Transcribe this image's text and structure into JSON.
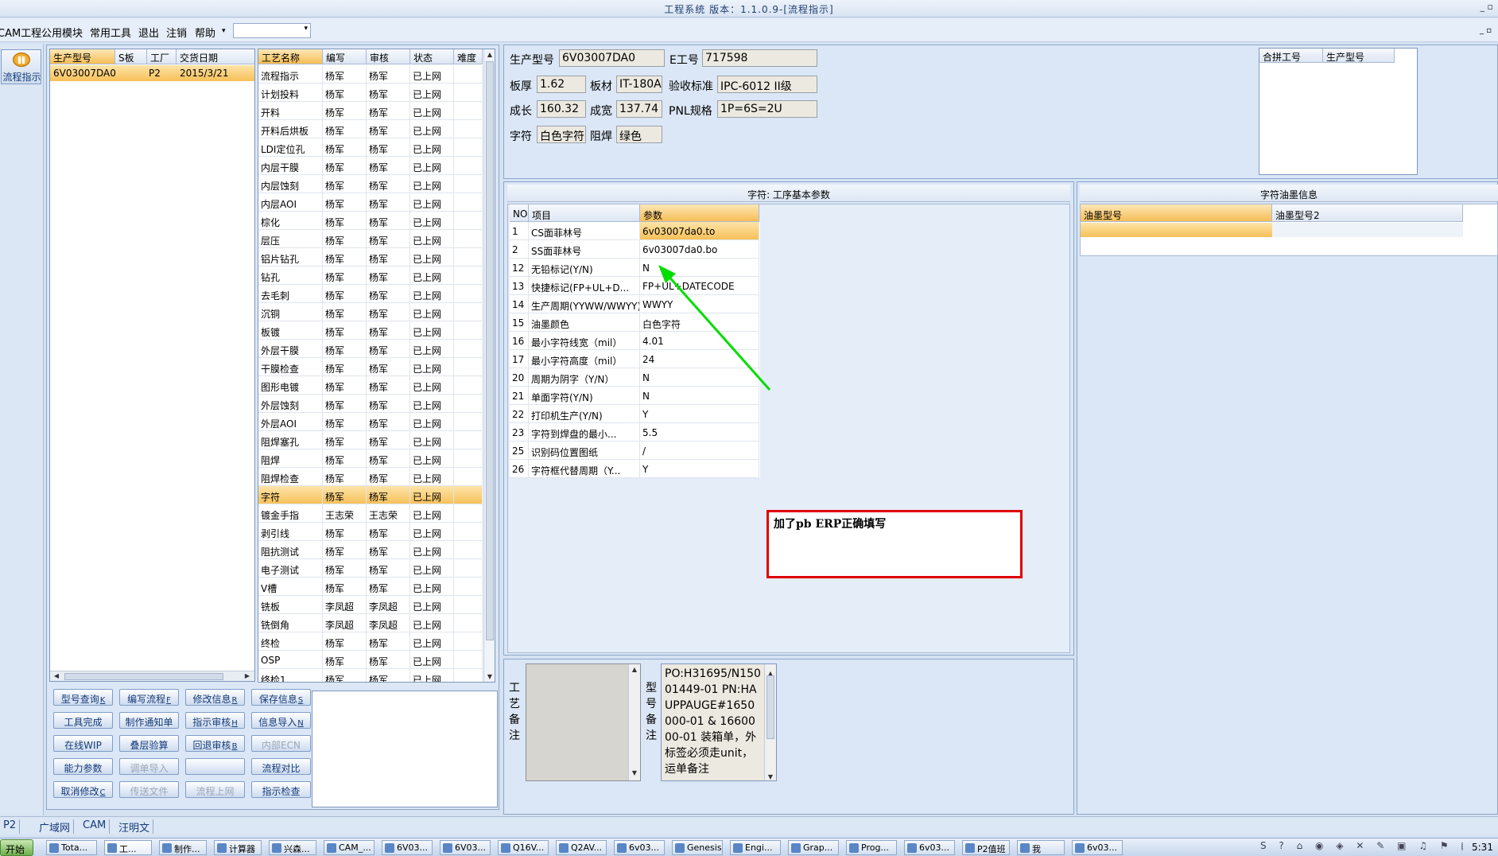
{
  "window": {
    "title": "工程系统  版本：1.1.0.9-[流程指示]"
  },
  "menu": {
    "items": [
      "CAM工程",
      "公用模块",
      "常用工具",
      "退出",
      "注销",
      "帮助"
    ]
  },
  "sidebar": {
    "button_label": "流程指示"
  },
  "orders": {
    "headers": [
      "生产型号",
      "S板",
      "工厂",
      "交货日期"
    ],
    "rows": [
      [
        "6V03007DA0",
        "",
        "P2",
        "2015/3/21"
      ]
    ]
  },
  "process": {
    "headers": [
      "工艺名称",
      "编写",
      "审核",
      "状态",
      "难度"
    ],
    "rows": [
      [
        "流程指示",
        "杨军",
        "杨军",
        "已上网"
      ],
      [
        "计划投料",
        "杨军",
        "杨军",
        "已上网"
      ],
      [
        "开料",
        "杨军",
        "杨军",
        "已上网"
      ],
      [
        "开料后烘板",
        "杨军",
        "杨军",
        "已上网"
      ],
      [
        "LDI定位孔",
        "杨军",
        "杨军",
        "已上网"
      ],
      [
        "内层干膜",
        "杨军",
        "杨军",
        "已上网"
      ],
      [
        "内层蚀刻",
        "杨军",
        "杨军",
        "已上网"
      ],
      [
        "内层AOI",
        "杨军",
        "杨军",
        "已上网"
      ],
      [
        "棕化",
        "杨军",
        "杨军",
        "已上网"
      ],
      [
        "层压",
        "杨军",
        "杨军",
        "已上网"
      ],
      [
        "铝片钻孔",
        "杨军",
        "杨军",
        "已上网"
      ],
      [
        "钻孔",
        "杨军",
        "杨军",
        "已上网"
      ],
      [
        "去毛刺",
        "杨军",
        "杨军",
        "已上网"
      ],
      [
        "沉铜",
        "杨军",
        "杨军",
        "已上网"
      ],
      [
        "板镀",
        "杨军",
        "杨军",
        "已上网"
      ],
      [
        "外层干膜",
        "杨军",
        "杨军",
        "已上网"
      ],
      [
        "干膜检查",
        "杨军",
        "杨军",
        "已上网"
      ],
      [
        "图形电镀",
        "杨军",
        "杨军",
        "已上网"
      ],
      [
        "外层蚀刻",
        "杨军",
        "杨军",
        "已上网"
      ],
      [
        "外层AOI",
        "杨军",
        "杨军",
        "已上网"
      ],
      [
        "阻焊塞孔",
        "杨军",
        "杨军",
        "已上网"
      ],
      [
        "阻焊",
        "杨军",
        "杨军",
        "已上网"
      ],
      [
        "阻焊检查",
        "杨军",
        "杨军",
        "已上网"
      ],
      [
        "字符",
        "杨军",
        "杨军",
        "已上网"
      ],
      [
        "镀金手指",
        "王志荣",
        "王志荣",
        "已上网"
      ],
      [
        "剥引线",
        "杨军",
        "杨军",
        "已上网"
      ],
      [
        "阻抗测试",
        "杨军",
        "杨军",
        "已上网"
      ],
      [
        "电子测试",
        "杨军",
        "杨军",
        "已上网"
      ],
      [
        "V槽",
        "杨军",
        "杨军",
        "已上网"
      ],
      [
        "铣板",
        "李凤超",
        "李凤超",
        "已上网"
      ],
      [
        "铣倒角",
        "李凤超",
        "李凤超",
        "已上网"
      ],
      [
        "终检",
        "杨军",
        "杨军",
        "已上网"
      ],
      [
        "OSP",
        "杨军",
        "杨军",
        "已上网"
      ],
      [
        "终检1",
        "杨军",
        "杨军",
        "已上网"
      ]
    ],
    "selected_index": 23
  },
  "buttons": [
    [
      "型号查询",
      "编写流程",
      "修改信息",
      "保存信息"
    ],
    [
      "工具完成",
      "制作通知单",
      "指示审核",
      "信息导入"
    ],
    [
      "在线WIP",
      "叠层验算",
      "回退审核",
      "内部ECN"
    ],
    [
      "能力参数",
      "调单导入",
      "",
      "流程对比"
    ],
    [
      "取消修改",
      "传送文件",
      "流程上网",
      "指示检查"
    ]
  ],
  "button_shortcuts": [
    [
      "K",
      "F",
      "R",
      "S"
    ],
    [
      "",
      "",
      "H",
      "N"
    ],
    [
      "",
      "",
      "B",
      ""
    ],
    [
      "",
      "",
      "",
      ""
    ],
    [
      "C",
      "",
      "",
      ""
    ]
  ],
  "disabled_buttons": [
    "内部ECN",
    "调单导入",
    "传送文件",
    "流程上网",
    ""
  ],
  "product": {
    "model_label": "生产型号",
    "model": "6V03007DA0",
    "e_label": "E工号",
    "e_no": "717598",
    "thickness_label": "板厚",
    "thickness": "1.62",
    "material_label": "板材",
    "material": "IT-180A",
    "standard_label": "验收标准",
    "standard": "IPC-6012 II级",
    "length_label": "成长",
    "length": "160.32",
    "width_label": "成宽",
    "width": "137.74",
    "pnl_label": "PNL规格",
    "pnl": "1P=6S=2U",
    "char_label": "字符",
    "char_color": "白色字符",
    "mask_label": "阻焊",
    "mask_color": "绿色"
  },
  "merge": {
    "headers": [
      "合拼工号",
      "生产型号"
    ]
  },
  "params": {
    "title": "字符: 工序基本参数",
    "headers": [
      "NO",
      "项目",
      "参数"
    ],
    "rows": [
      [
        "1",
        "CS面菲林号",
        "6v03007da0.to"
      ],
      [
        "2",
        "SS面菲林号",
        "6v03007da0.bo"
      ],
      [
        "12",
        "无铅标记(Y/N)",
        "N"
      ],
      [
        "13",
        "快捷标记(FP+UL+D...",
        "FP+UL+DATECODE"
      ],
      [
        "14",
        "生产周期(YYWW/WWYY)",
        "WWYY"
      ],
      [
        "15",
        "油墨颜色",
        "白色字符"
      ],
      [
        "16",
        "最小字符线宽（mil）",
        "4.01"
      ],
      [
        "17",
        "最小字符高度（mil）",
        "24"
      ],
      [
        "20",
        "周期为阴字（Y/N）",
        "N"
      ],
      [
        "21",
        "单面字符(Y/N)",
        "N"
      ],
      [
        "22",
        "打印机生产(Y/N)",
        "Y"
      ],
      [
        "23",
        "字符到焊盘的最小...",
        "5.5"
      ],
      [
        "25",
        "识别码位置图纸",
        "/"
      ],
      [
        "26",
        "字符框代替周期（Y...",
        "Y"
      ]
    ]
  },
  "ink": {
    "title": "字符油墨信息",
    "headers": [
      "油墨型号",
      "油墨型号2"
    ]
  },
  "annotation": {
    "text": "加了pb ERP正确填写",
    "arrow_color": "#00dd00",
    "box_color": "#e00000"
  },
  "notes": {
    "process_label": "工艺备注",
    "model_label": "型号备注",
    "model_notes": "PO:H31695/N15001449-01 PN:HAUPPAUGE#1650000-01 & 1660000-01  装箱单，外标签必须走unit，运单备注"
  },
  "status": {
    "factory": "P2",
    "tabs": [
      "广域网",
      "CAM",
      "汪明文"
    ]
  },
  "taskbar": {
    "start": "开始",
    "items": [
      "Tota...",
      "工...",
      "制作...",
      "计算器",
      "兴森...",
      "CAM_...",
      "6V03...",
      "6V03...",
      "Q16V...",
      "Q2AV...",
      "6v03...",
      "Genesis",
      "Engi...",
      "Grap...",
      "Prog...",
      "6v03...",
      "P2值班",
      "我",
      "6v03..."
    ],
    "clock": "5:31"
  }
}
